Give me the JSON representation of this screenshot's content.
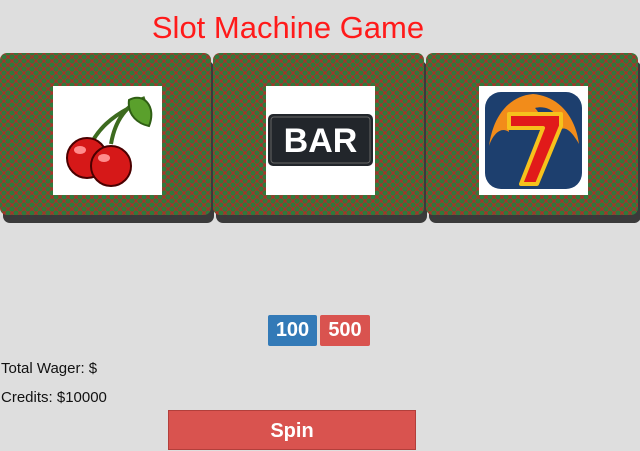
{
  "title": "Slot Machine Game",
  "reels": [
    {
      "symbol": "cherry-icon"
    },
    {
      "symbol": "bar-icon",
      "text": "BAR"
    },
    {
      "symbol": "seven-icon"
    }
  ],
  "bets": {
    "low_label": "100",
    "high_label": "500",
    "low_color": "#337ab7",
    "high_color": "#d9534f"
  },
  "status": {
    "wager_label": "Total Wager: $",
    "credits_label": "Credits: $10000"
  },
  "spin_label": "Spin"
}
